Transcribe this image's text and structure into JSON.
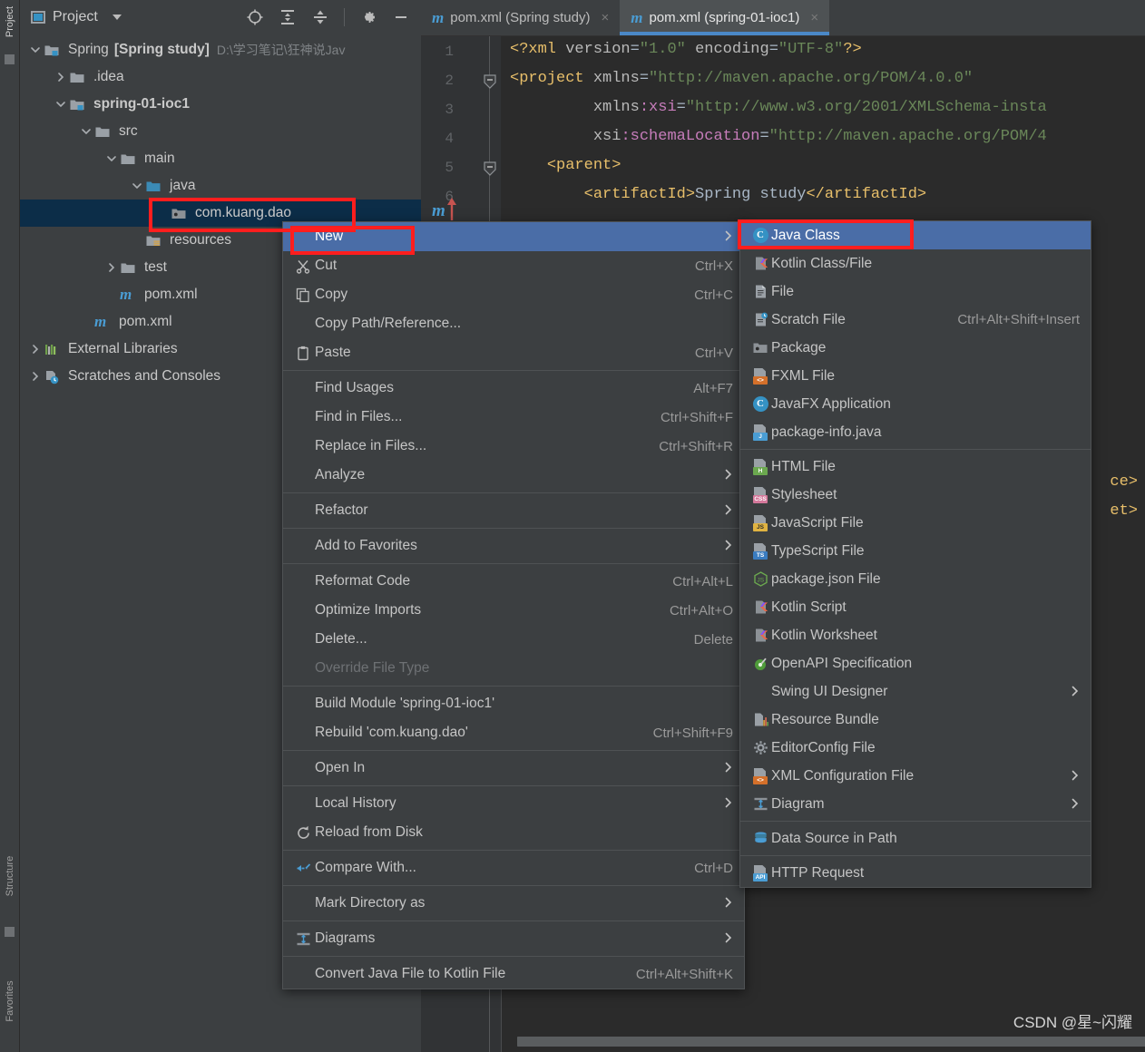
{
  "tool_strip": {
    "tabs": [
      {
        "label": "Project",
        "active": true
      },
      {
        "label": "Structure",
        "active": false
      },
      {
        "label": "Favorites",
        "active": false
      }
    ]
  },
  "project_panel": {
    "title": "Project",
    "toolbar_icons": [
      "locate-target-icon",
      "expand-all-icon",
      "collapse-all-icon",
      "gear-icon",
      "minimize-icon"
    ],
    "tree": [
      {
        "label": "Spring",
        "bold_label": "[Spring study]",
        "path": "D:\\学习笔记\\狂神说Jav",
        "icon": "module-folder-icon",
        "indent": 0,
        "arrow": "down",
        "selected": false
      },
      {
        "label": ".idea",
        "icon": "folder-icon",
        "indent": 1,
        "arrow": "right",
        "selected": false
      },
      {
        "label": "spring-01-ioc1",
        "icon": "module-folder-icon",
        "indent": 1,
        "arrow": "down",
        "selected": false,
        "bold": true
      },
      {
        "label": "src",
        "icon": "folder-icon",
        "indent": 2,
        "arrow": "down",
        "selected": false
      },
      {
        "label": "main",
        "icon": "folder-icon",
        "indent": 3,
        "arrow": "down",
        "selected": false
      },
      {
        "label": "java",
        "icon": "source-root-folder-icon",
        "indent": 4,
        "arrow": "down",
        "selected": false
      },
      {
        "label": "com.kuang.dao",
        "icon": "package-icon",
        "indent": 5,
        "arrow": "none",
        "selected": true
      },
      {
        "label": "resources",
        "icon": "resource-root-folder-icon",
        "indent": 4,
        "arrow": "none",
        "selected": false
      },
      {
        "label": "test",
        "icon": "folder-icon",
        "indent": 3,
        "arrow": "right",
        "selected": false
      },
      {
        "label": "pom.xml",
        "icon": "maven-icon",
        "indent": 3,
        "arrow": "none",
        "selected": false
      },
      {
        "label": "pom.xml",
        "icon": "maven-icon",
        "indent": 2,
        "arrow": "none",
        "selected": false
      },
      {
        "label": "External Libraries",
        "icon": "library-icon",
        "indent": 0,
        "arrow": "right",
        "selected": false
      },
      {
        "label": "Scratches and Consoles",
        "icon": "scratches-icon",
        "indent": 0,
        "arrow": "right",
        "selected": false
      }
    ]
  },
  "editor": {
    "tabs": [
      {
        "label": "pom.xml (Spring study)",
        "icon": "maven-icon",
        "active": false,
        "close": "×"
      },
      {
        "label": "pom.xml (spring-01-ioc1)",
        "icon": "maven-icon",
        "active": true,
        "close": "×"
      }
    ],
    "line_numbers": [
      "1",
      "2",
      "3",
      "4",
      "5",
      "6"
    ],
    "code_lines": [
      "<?xml version=\"1.0\" encoding=\"UTF-8\"?>",
      "<project xmlns=\"http://maven.apache.org/POM/4.0.0\"",
      "         xmlns:xsi=\"http://www.w3.org/2001/XMLSchema-insta",
      "         xsi:schemaLocation=\"http://maven.apache.org/POM/4",
      "    <parent>",
      "        <artifactId>Spring study</artifactId>"
    ],
    "obscured_fragments": [
      "ce>",
      "et>"
    ]
  },
  "context_menu": {
    "items": [
      {
        "label": "New",
        "mnemonic": "N",
        "icon": "",
        "shortcut": "",
        "submenu": true,
        "highlighted": true
      },
      {
        "label": "Cut",
        "mnemonic": "t",
        "icon": "scissors-icon",
        "shortcut": "Ctrl+X"
      },
      {
        "label": "Copy",
        "mnemonic": "C",
        "icon": "copy-icon",
        "shortcut": "Ctrl+C"
      },
      {
        "label": "Copy Path/Reference...",
        "icon": "",
        "shortcut": ""
      },
      {
        "label": "Paste",
        "mnemonic": "P",
        "icon": "clipboard-icon",
        "shortcut": "Ctrl+V"
      },
      {
        "separator": true
      },
      {
        "label": "Find Usages",
        "mnemonic": "U",
        "icon": "",
        "shortcut": "Alt+F7"
      },
      {
        "label": "Find in Files...",
        "icon": "",
        "shortcut": "Ctrl+Shift+F"
      },
      {
        "label": "Replace in Files...",
        "mnemonic": "a",
        "icon": "",
        "shortcut": "Ctrl+Shift+R"
      },
      {
        "label": "Analyze",
        "mnemonic": "z",
        "icon": "",
        "shortcut": "",
        "submenu": true
      },
      {
        "separator": true
      },
      {
        "label": "Refactor",
        "mnemonic": "R",
        "icon": "",
        "shortcut": "",
        "submenu": true
      },
      {
        "separator": true
      },
      {
        "label": "Add to Favorites",
        "mnemonic": "F",
        "icon": "",
        "shortcut": "",
        "submenu": true
      },
      {
        "separator": true
      },
      {
        "label": "Reformat Code",
        "mnemonic": "R",
        "icon": "",
        "shortcut": "Ctrl+Alt+L"
      },
      {
        "label": "Optimize Imports",
        "mnemonic": "z",
        "icon": "",
        "shortcut": "Ctrl+Alt+O"
      },
      {
        "label": "Delete...",
        "mnemonic": "D",
        "icon": "",
        "shortcut": "Delete"
      },
      {
        "label": "Override File Type",
        "icon": "",
        "shortcut": "",
        "disabled": true
      },
      {
        "separator": true
      },
      {
        "label": "Build Module 'spring-01-ioc1'",
        "mnemonic": "M",
        "icon": "",
        "shortcut": ""
      },
      {
        "label": "Rebuild 'com.kuang.dao'",
        "mnemonic": "e",
        "icon": "",
        "shortcut": "Ctrl+Shift+F9"
      },
      {
        "separator": true
      },
      {
        "label": "Open In",
        "icon": "",
        "shortcut": "",
        "submenu": true
      },
      {
        "separator": true
      },
      {
        "label": "Local History",
        "mnemonic": "H",
        "icon": "",
        "shortcut": "",
        "submenu": true
      },
      {
        "label": "Reload from Disk",
        "icon": "reload-icon",
        "shortcut": ""
      },
      {
        "separator": true
      },
      {
        "label": "Compare With...",
        "icon": "compare-icon",
        "shortcut": "Ctrl+D"
      },
      {
        "separator": true
      },
      {
        "label": "Mark Directory as",
        "icon": "",
        "shortcut": "",
        "submenu": true
      },
      {
        "separator": true
      },
      {
        "label": "Diagrams",
        "icon": "diagram-icon",
        "shortcut": "",
        "submenu": true
      },
      {
        "separator": true
      },
      {
        "label": "Convert Java File to Kotlin File",
        "icon": "",
        "shortcut": "Ctrl+Alt+Shift+K"
      }
    ]
  },
  "sub_menu": {
    "items": [
      {
        "label": "Java Class",
        "icon": "java-class-icon",
        "shortcut": "",
        "highlighted": true
      },
      {
        "label": "Kotlin Class/File",
        "icon": "kotlin-file-icon",
        "shortcut": ""
      },
      {
        "label": "File",
        "icon": "file-icon",
        "shortcut": ""
      },
      {
        "label": "Scratch File",
        "icon": "scratch-file-icon",
        "shortcut": "Ctrl+Alt+Shift+Insert"
      },
      {
        "label": "Package",
        "icon": "package-icon",
        "shortcut": ""
      },
      {
        "label": "FXML File",
        "icon": "fxml-file-icon",
        "shortcut": ""
      },
      {
        "label": "JavaFX Application",
        "icon": "javafx-app-icon",
        "shortcut": ""
      },
      {
        "label": "package-info.java",
        "icon": "java-file-icon",
        "shortcut": ""
      },
      {
        "separator": true
      },
      {
        "label": "HTML File",
        "icon": "html-file-icon",
        "shortcut": ""
      },
      {
        "label": "Stylesheet",
        "icon": "css-file-icon",
        "shortcut": ""
      },
      {
        "label": "JavaScript File",
        "icon": "js-file-icon",
        "shortcut": ""
      },
      {
        "label": "TypeScript File",
        "icon": "ts-file-icon",
        "shortcut": ""
      },
      {
        "label": "package.json File",
        "icon": "nodejs-icon",
        "shortcut": ""
      },
      {
        "label": "Kotlin Script",
        "icon": "kotlin-script-icon",
        "shortcut": ""
      },
      {
        "label": "Kotlin Worksheet",
        "icon": "kotlin-worksheet-icon",
        "shortcut": ""
      },
      {
        "label": "OpenAPI Specification",
        "icon": "openapi-icon",
        "shortcut": ""
      },
      {
        "label": "Swing UI Designer",
        "icon": "",
        "shortcut": "",
        "submenu": true
      },
      {
        "label": "Resource Bundle",
        "icon": "resource-bundle-icon",
        "shortcut": ""
      },
      {
        "label": "EditorConfig File",
        "icon": "gear-icon",
        "shortcut": ""
      },
      {
        "label": "XML Configuration File",
        "icon": "xml-file-icon",
        "shortcut": "",
        "submenu": true
      },
      {
        "label": "Diagram",
        "icon": "diagram-icon",
        "shortcut": "",
        "submenu": true
      },
      {
        "separator": true
      },
      {
        "label": "Data Source in Path",
        "icon": "database-icon",
        "shortcut": ""
      },
      {
        "separator": true
      },
      {
        "label": "HTTP Request",
        "icon": "http-request-icon",
        "shortcut": ""
      }
    ]
  },
  "annotations": {
    "boxes": [
      "com-kuang-dao-highlight",
      "new-menu-highlight",
      "java-class-highlight"
    ],
    "color": "#FF1E1E"
  },
  "watermark": "CSDN @星~闪耀",
  "colors": {
    "panel_bg": "#3C3F41",
    "editor_bg": "#2B2B2B",
    "menu_highlight": "#4A6DA7",
    "tree_selection": "#0C2D48",
    "accent_blue": "#3592C4",
    "annotation_red": "#FF1E1E"
  }
}
